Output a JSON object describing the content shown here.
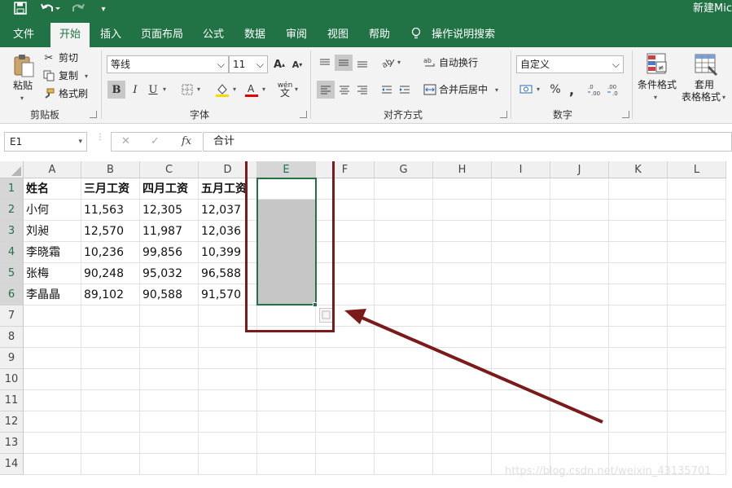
{
  "titlebar": {
    "save_icon": "save-icon",
    "undo_icon": "undo-icon",
    "redo_icon": "redo-icon",
    "customize_icon": "customize-qat-icon",
    "title": "新建Mic"
  },
  "menu": {
    "tabs": [
      "文件",
      "开始",
      "插入",
      "页面布局",
      "公式",
      "数据",
      "审阅",
      "视图",
      "帮助"
    ],
    "active_tab": "开始",
    "tell_me": "操作说明搜索"
  },
  "ribbon": {
    "clipboard": {
      "label": "剪贴板",
      "paste": "粘贴",
      "cut": "剪切",
      "copy": "复制",
      "format_painter": "格式刷"
    },
    "font": {
      "label": "字体",
      "font_name": "等线",
      "font_size": "11",
      "grow": "A",
      "shrink": "A",
      "bold": "B",
      "italic": "I",
      "underline": "U",
      "phonetic": "wén"
    },
    "alignment": {
      "label": "对齐方式",
      "wrap_text": "自动换行",
      "merge_center": "合并后居中"
    },
    "number": {
      "label": "数字",
      "format": "自定义",
      "percent": "%",
      "comma": ","
    },
    "styles": {
      "conditional_format": "条件格式",
      "table_format_line1": "套用",
      "table_format_line2": "表格格式"
    }
  },
  "formula_bar": {
    "name_box": "E1",
    "cancel": "✕",
    "enter": "✓",
    "fx": "fx",
    "formula": "合计"
  },
  "sheet": {
    "columns": [
      "A",
      "B",
      "C",
      "D",
      "E",
      "F",
      "G",
      "H",
      "I",
      "J",
      "K",
      "L"
    ],
    "rows": [
      "1",
      "2",
      "3",
      "4",
      "5",
      "6",
      "7",
      "8",
      "9",
      "10",
      "11",
      "12",
      "13",
      "14"
    ],
    "selected_column": "E",
    "selected_range": "E1:E6",
    "active_cell": "E1",
    "data": [
      [
        "姓名",
        "三月工资",
        "四月工资",
        "五月工资"
      ],
      [
        "小何",
        "11,563",
        "12,305",
        "12,037"
      ],
      [
        "刘昶",
        "12,570",
        "11,987",
        "12,036"
      ],
      [
        "李晓霜",
        "10,236",
        "99,856",
        "10,399"
      ],
      [
        "张梅",
        "90,248",
        "95,032",
        "96,588"
      ],
      [
        "李晶晶",
        "89,102",
        "90,588",
        "91,570"
      ]
    ]
  },
  "colors": {
    "accent": "#217346",
    "annotation": "#7a1a1a",
    "selection_fill": "#c6c6c6"
  },
  "watermark": "https://blog.csdn.net/weixin_43135701"
}
